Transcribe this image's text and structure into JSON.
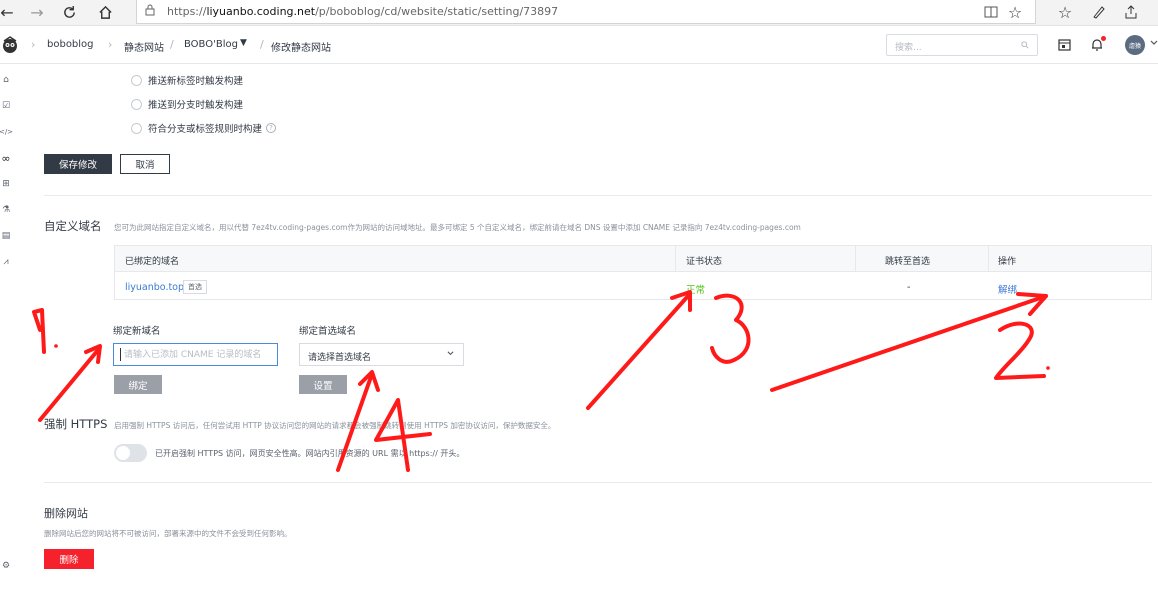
{
  "browser": {
    "url_scheme": "https://",
    "url_host": "liyuanbo.coding.net",
    "url_path": "/p/boboblog/cd/website/static/setting/73897"
  },
  "header": {
    "breadcrumbs": [
      "boboblog",
      "静态网站",
      "BOBO'Blog",
      "修改静态网站"
    ],
    "search_placeholder": "搜索...",
    "avatar_text": "虐猿"
  },
  "trigger_options": [
    "推送新标签时触发构建",
    "推送到分支时触发构建",
    "符合分支或标签规则时构建"
  ],
  "actions": {
    "save": "保存修改",
    "cancel": "取消"
  },
  "custom_domain": {
    "title": "自定义域名",
    "desc": "您可为此网站指定自定义域名，用以代替 7ez4tv.coding-pages.com作为网站的访问域地址。最多可绑定 5 个自定义域名，绑定前请在域名 DNS 设置中添加 CNAME 记录指向 7ez4tv.coding-pages.com",
    "columns": [
      "已绑定的域名",
      "证书状态",
      "跳转至首选",
      "操作"
    ],
    "rows": [
      {
        "domain": "liyuanbo.top",
        "tag": "首选",
        "cert": "正常",
        "redirect": "-",
        "action": "解绑"
      }
    ],
    "bind_label": "绑定新域名",
    "bind_placeholder": "请输入已添加 CNAME 记录的域名",
    "bind_button": "绑定",
    "preferred_label": "绑定首选域名",
    "preferred_value": "请选择首选域名",
    "preferred_button": "设置"
  },
  "https": {
    "title": "强制 HTTPS",
    "desc": "启用强制 HTTPS 访问后，任何尝试用 HTTP 协议访问您的网站的请求都会被强制跳转到使用 HTTPS 加密协议访问，保护数据安全。",
    "toggle_note": "已开启强制 HTTPS 访问，网页安全性高。网站内引用资源的 URL 需以 https:// 开头。"
  },
  "delete_site": {
    "title": "删除网站",
    "desc": "删除网站后您的网站将不可被访问，部署来源中的文件不会受到任何影响。",
    "button": "删除"
  },
  "annotations": [
    "1.",
    "2.",
    "3",
    "4"
  ],
  "colors": {
    "accent": "#3a7bd5",
    "success": "#52c41a",
    "danger": "#f5222d",
    "dark": "#323a45",
    "annotation": "#ff1a1a"
  }
}
